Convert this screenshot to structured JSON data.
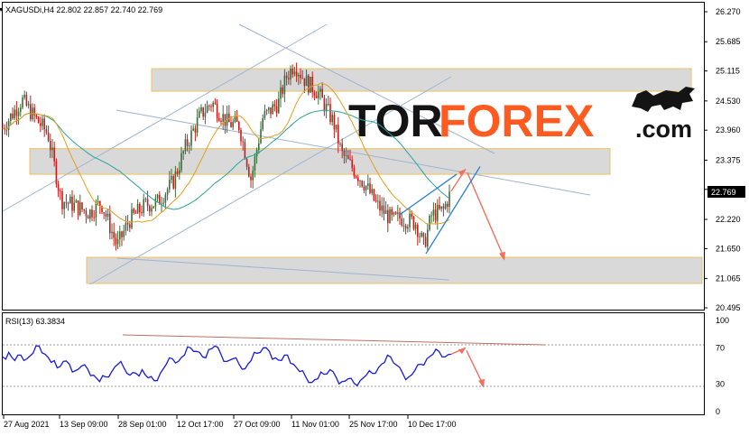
{
  "header": {
    "symbol_line": "XAGUSDi,H4 22.802 22.857 22.740 22.769",
    "rsi_line": "RSI(13) 63.3834"
  },
  "watermark": {
    "text_dark": "TOR",
    "text_accent": "FOREX",
    "text_suffix": ".com",
    "color_dark": "#141414",
    "color_accent": "#ff5a1f"
  },
  "colors": {
    "candle_up": "#3a6e3a",
    "candle_down": "#cc1b1b",
    "ma_fast": "#e0a020",
    "ma_slow": "#2ba39a",
    "channel": "#9fb4d0",
    "zone_fill": "#d9d9d9",
    "zone_border": "#f0c060",
    "rsi_line": "#1a1adc",
    "forecast_arrow": "#f07060",
    "wedge_line": "#2a7fd8",
    "price_tag_bg": "#000000"
  },
  "chart_data": [
    {
      "type": "candlestick",
      "symbol": "XAGUSDi",
      "timeframe": "H4",
      "ohlc_last": {
        "open": 22.802,
        "high": 22.857,
        "low": 22.74,
        "close": 22.769
      },
      "current_price_label": "22.769",
      "y_ticks": [
        "26.270",
        "25.685",
        "25.115",
        "24.530",
        "23.960",
        "23.375",
        "22.805",
        "22.220",
        "21.650",
        "21.065",
        "20.495"
      ],
      "ylim": [
        20.495,
        26.27
      ],
      "x_ticks": [
        "27 Aug 2021",
        "13 Sep 09:00",
        "28 Sep 01:00",
        "12 Oct 17:00",
        "27 Oct 09:00",
        "11 Nov 01:00",
        "25 Nov 17:00",
        "10 Dec 17:00"
      ],
      "close_path": [
        [
          "27 Aug 2021",
          24.0
        ],
        [
          "2 Sep 2021",
          24.55
        ],
        [
          "6 Sep 2021",
          24.2
        ],
        [
          "10 Sep 2021",
          23.9
        ],
        [
          "14 Sep 2021",
          22.6
        ],
        [
          "17 Sep 2021",
          22.5
        ],
        [
          "21 Sep 2021",
          22.35
        ],
        [
          "24 Sep 2021",
          22.55
        ],
        [
          "28 Sep 2021",
          21.7
        ],
        [
          "1 Oct 2021",
          22.2
        ],
        [
          "5 Oct 2021",
          22.5
        ],
        [
          "8 Oct 2021",
          22.55
        ],
        [
          "12 Oct 2021",
          22.95
        ],
        [
          "15 Oct 2021",
          23.6
        ],
        [
          "19 Oct 2021",
          24.25
        ],
        [
          "22 Oct 2021",
          24.5
        ],
        [
          "26 Oct 2021",
          24.1
        ],
        [
          "29 Oct 2021",
          24.05
        ],
        [
          "1 Nov 2021",
          23.0
        ],
        [
          "4 Nov 2021",
          24.2
        ],
        [
          "8 Nov 2021",
          24.5
        ],
        [
          "10 Nov 2021",
          25.0
        ],
        [
          "12 Nov 2021",
          25.25
        ],
        [
          "15 Nov 2021",
          24.9
        ],
        [
          "18 Nov 2021",
          24.7
        ],
        [
          "22 Nov 2021",
          24.1
        ],
        [
          "24 Nov 2021",
          23.5
        ],
        [
          "26 Nov 2021",
          23.3
        ],
        [
          "30 Nov 2021",
          22.9
        ],
        [
          "3 Dec 2021",
          22.5
        ],
        [
          "7 Dec 2021",
          22.2
        ],
        [
          "9 Dec 2021",
          22.25
        ],
        [
          "13 Dec 2021",
          22.15
        ],
        [
          "15 Dec 2021",
          21.7
        ],
        [
          "17 Dec 2021",
          22.3
        ],
        [
          "20 Dec 2021",
          22.4
        ],
        [
          "22 Dec 2021",
          22.769
        ]
      ],
      "support_resistance_zones": [
        {
          "upper": 25.16,
          "lower": 24.72
        },
        {
          "upper": 23.6,
          "lower": 23.1
        },
        {
          "upper": 21.48,
          "lower": 20.97
        }
      ],
      "forecast": {
        "direction": "up-then-down",
        "peak": 23.2,
        "target": 21.45
      }
    },
    {
      "type": "line",
      "name": "RSI(13)",
      "last_value": 63.3834,
      "y_ticks": [
        "100",
        "70",
        "30",
        "0"
      ],
      "levels": [
        70,
        30
      ],
      "ylim": [
        0,
        100
      ],
      "values": [
        60,
        65,
        56,
        62,
        58,
        64,
        72,
        63,
        54,
        48,
        55,
        52,
        45,
        50,
        47,
        40,
        33,
        38,
        44,
        52,
        48,
        40,
        42,
        46,
        37,
        34,
        42,
        52,
        58,
        55,
        62,
        70,
        66,
        60,
        68,
        72,
        63,
        55,
        58,
        52,
        47,
        56,
        64,
        70,
        66,
        59,
        56,
        62,
        52,
        44,
        38,
        32,
        36,
        41,
        46,
        38,
        33,
        36,
        31,
        34,
        40,
        42,
        48,
        54,
        60,
        51,
        42,
        38,
        45,
        52,
        58,
        63,
        66,
        60,
        63
      ],
      "trendline": {
        "start": 77,
        "end": 68
      },
      "forecast": {
        "peak": 70,
        "target": 28
      }
    }
  ]
}
